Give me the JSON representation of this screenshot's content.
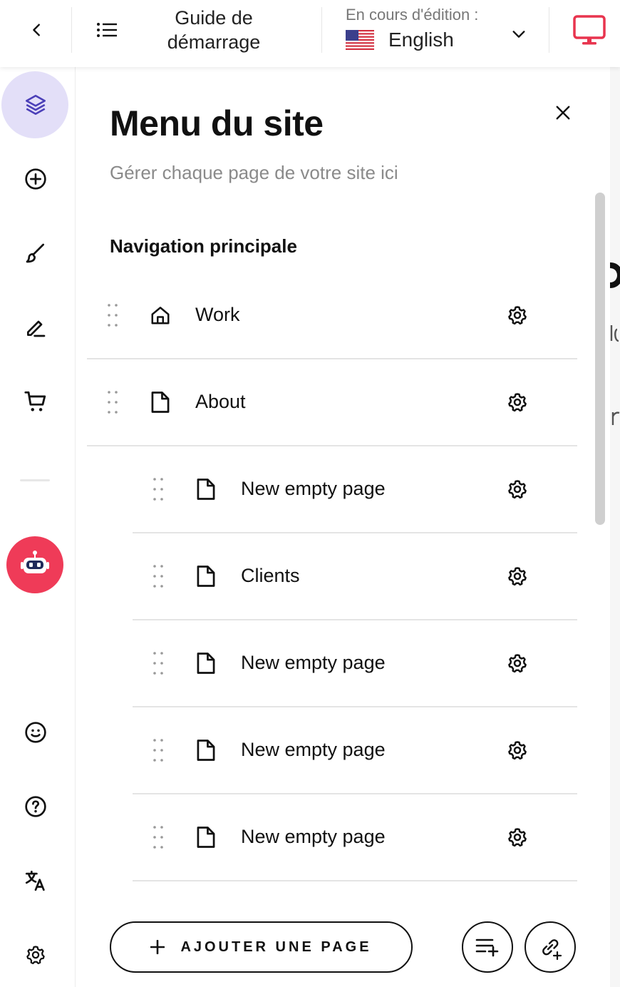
{
  "topbar": {
    "back_icon": "chevron-left-icon",
    "menu_icon": "list-icon",
    "guide_line1": "Guide de",
    "guide_line2": "démarrage",
    "editing_label": "En cours d'édition :",
    "language": "English",
    "language_flag": "us-flag-icon",
    "dropdown_icon": "chevron-down-icon",
    "device_icon": "monitor-icon",
    "device_color": "#e8344e"
  },
  "rail": {
    "items": [
      {
        "name": "layers-icon",
        "active": true
      },
      {
        "name": "add-circle-icon"
      },
      {
        "name": "brush-icon"
      },
      {
        "name": "pen-icon"
      },
      {
        "name": "cart-icon"
      },
      {
        "name": "robot-icon"
      },
      {
        "name": "smiley-icon"
      },
      {
        "name": "help-icon"
      },
      {
        "name": "translate-icon"
      },
      {
        "name": "settings-icon"
      }
    ],
    "active_bg": "#e3dff8",
    "robot_bg": "#ef3b58"
  },
  "panel": {
    "title": "Menu du site",
    "subtitle": "Gérer chaque page de votre site ici",
    "section_title": "Navigation principale",
    "pages": [
      {
        "label": "Work",
        "icon": "home-icon",
        "indent": 0
      },
      {
        "label": "About",
        "icon": "page-icon",
        "indent": 0
      },
      {
        "label": "New empty page",
        "icon": "page-icon",
        "indent": 1
      },
      {
        "label": "Clients",
        "icon": "page-icon",
        "indent": 1
      },
      {
        "label": "New empty page",
        "icon": "page-icon",
        "indent": 1
      },
      {
        "label": "New empty page",
        "icon": "page-icon",
        "indent": 1
      },
      {
        "label": "New empty page",
        "icon": "page-icon",
        "indent": 1
      }
    ],
    "add_page_label": "AJOUTER UNE PAGE"
  }
}
